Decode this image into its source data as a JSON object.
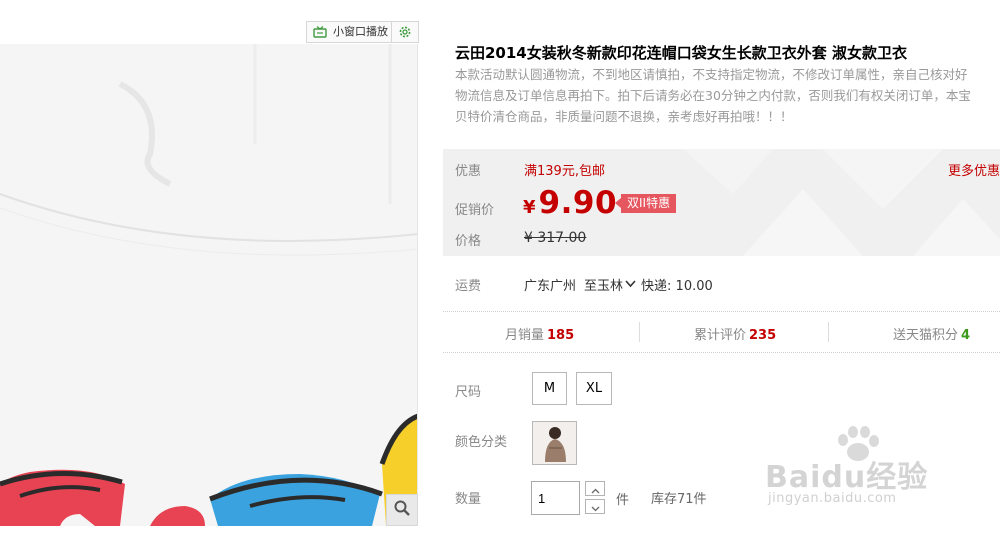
{
  "mini_window": {
    "label": "小窗口播放",
    "icon": "tv-icon",
    "settings_icon": "gear-icon"
  },
  "product": {
    "title": "云田2014女装秋冬新款印花连帽口袋女生长款卫衣外套 淑女款卫衣",
    "subtitle_lines": [
      "本款活动默认圆通物流，不到地区请慎拍，不支持指定物流，不修改订单属性，亲自己核对好",
      "物流信息及订单信息再拍下。拍下后请务必在30分钟之内付款，否则我们有权关闭订单，本宝",
      "贝特价清仓商品，非质量问题不退换，亲考虑好再拍哦！！！"
    ]
  },
  "pricing": {
    "promo_label": "优惠",
    "promo_value": "满139元,包邮",
    "more_label": "更多优惠",
    "sale_label": "促销价",
    "currency": "¥",
    "sale_price": "9.90",
    "badge": "双II特惠",
    "price_label": "价格",
    "original_price": "¥ 317.00"
  },
  "shipping": {
    "label": "运费",
    "origin": "广东广州",
    "destination": "至玉林",
    "express": "快递: 10.00"
  },
  "stats": {
    "monthly_sales_label": "月销量",
    "monthly_sales": "185",
    "reviews_label": "累计评价",
    "reviews": "235",
    "points_label": "送天猫积分",
    "points": "4"
  },
  "options": {
    "size_label": "尺码",
    "sizes": [
      "M",
      "XL"
    ],
    "color_label": "颜色分类"
  },
  "quantity": {
    "label": "数量",
    "value": "1",
    "unit": "件",
    "stock": "库存71件"
  },
  "watermark": {
    "main": "Baidu经验",
    "sub": "jingyan.baidu.com"
  },
  "colors": {
    "accent_red": "#c40000",
    "badge_pink": "#e5565f",
    "points_green": "#3b9a1d",
    "mini_green": "#3f9a3f"
  }
}
